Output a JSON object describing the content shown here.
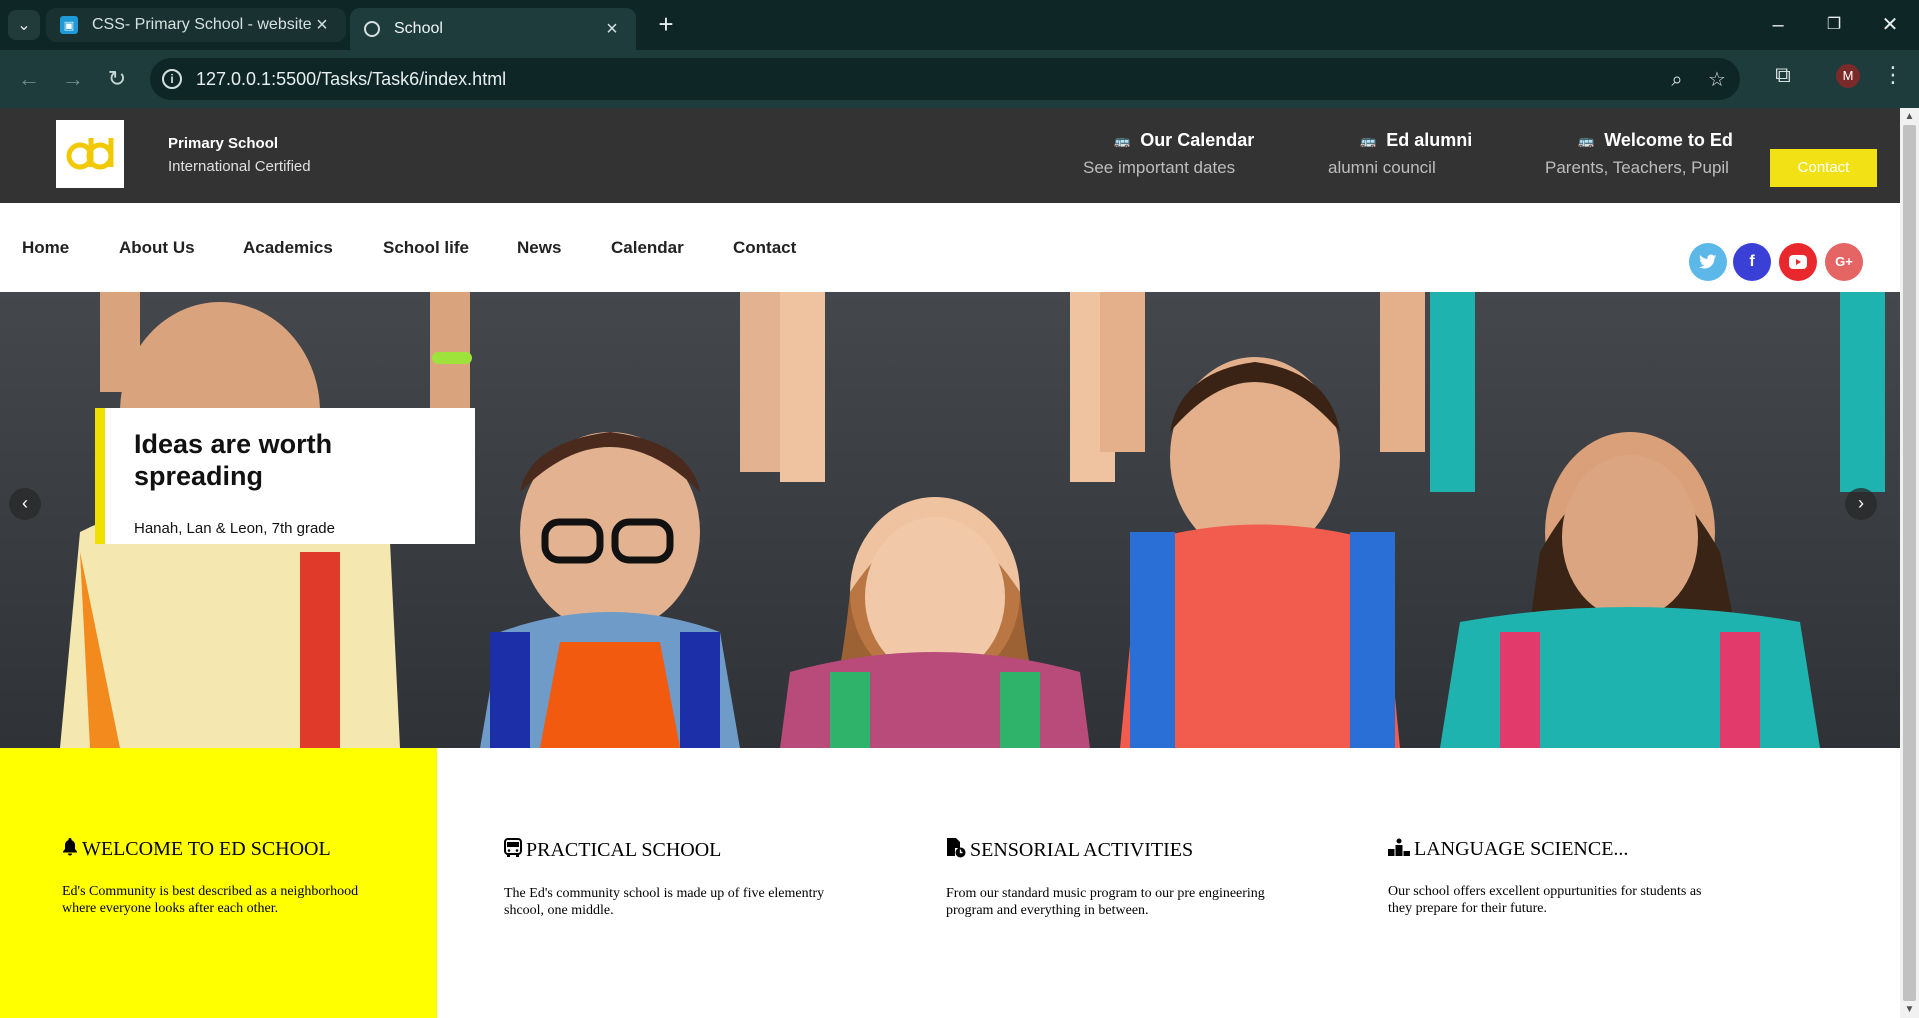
{
  "browser": {
    "tabs": [
      {
        "title": "CSS- Primary School - website",
        "active": false
      },
      {
        "title": "School",
        "active": true
      }
    ],
    "url": "127.0.0.1:5500/Tasks/Task6/index.html",
    "profile_initial": "M"
  },
  "topbar": {
    "logo_text": "dd",
    "brand_name": "Primary School",
    "brand_sub": "International Certified",
    "info": [
      {
        "title": "Our Calendar",
        "sub": "See important dates",
        "icon": "bus-icon"
      },
      {
        "title": "Ed alumni",
        "sub": "alumni council",
        "icon": "bus-icon"
      },
      {
        "title": "Welcome to Ed",
        "sub": "Parents, Teachers, Pupil",
        "icon": "bus-icon"
      }
    ],
    "contact_label": "Contact"
  },
  "nav": {
    "items": [
      "Home",
      "About Us",
      "Academics",
      "School life",
      "News",
      "Calendar",
      "Contact"
    ],
    "social": [
      {
        "name": "twitter",
        "glyph": "t",
        "color": "#5bb8e8"
      },
      {
        "name": "facebook",
        "glyph": "f",
        "color": "#3a3fd6"
      },
      {
        "name": "youtube",
        "glyph": "▶",
        "color": "#e8282c"
      },
      {
        "name": "google-plus",
        "glyph": "G+",
        "color": "#e56565"
      }
    ]
  },
  "hero": {
    "title": "Ideas are worth spreading",
    "subtitle": "Hanah, Lan & Leon, 7th grade",
    "prev": "‹",
    "next": "›"
  },
  "features": [
    {
      "icon": "bell-icon",
      "glyph": "🔔",
      "title": "WELCOME TO ED SCHOOL",
      "text": "Ed's Community is best described as a neighborhood where everyone looks after each other."
    },
    {
      "icon": "bus-icon",
      "glyph": "🚌",
      "title": "PRACTICAL SCHOOL",
      "text": "The Ed's community school is made up of five elementry shcool, one middle."
    },
    {
      "icon": "file-clock-icon",
      "glyph": "📄",
      "title": "SENSORIAL ACTIVITIES",
      "text": "From our standard music program to our pre engineering program and everything in between."
    },
    {
      "icon": "podium-icon",
      "glyph": "▟",
      "title": "LANGUAGE SCIENCE...",
      "text": "Our school offers excellent oppurtunities for students as they prepare for their future."
    }
  ],
  "colors": {
    "accent_yellow": "#ffff00",
    "contact_button": "#f2e114",
    "topbar_bg": "#333333"
  }
}
